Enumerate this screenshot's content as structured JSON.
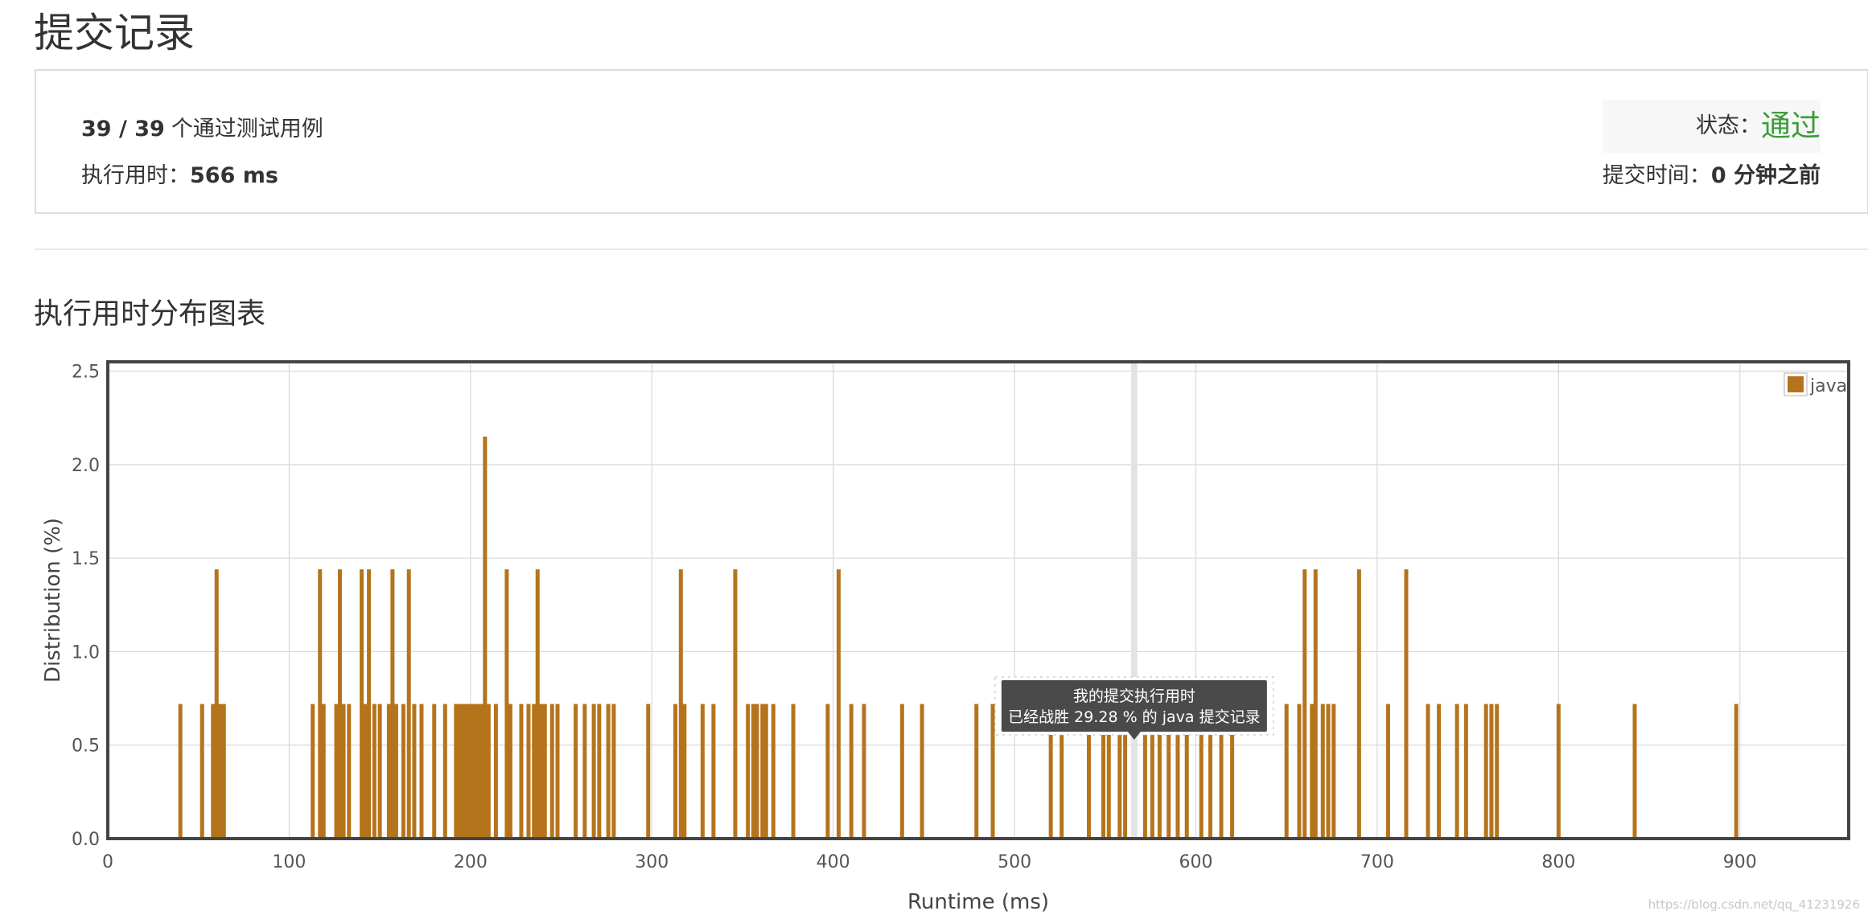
{
  "page": {
    "title": "提交记录",
    "watermark": "https://blog.csdn.net/qq_41231926"
  },
  "summary": {
    "testcases_passed": "39 / 39",
    "testcases_suffix": "个通过测试用例",
    "runtime_label": "执行用时：",
    "runtime_value": "566 ms",
    "status_label": "状态：",
    "status_value": "通过",
    "submit_time_label": "提交时间：",
    "submit_time_value": "0 分钟之前"
  },
  "colors": {
    "bar": "#b5741c",
    "status_green": "#3a9d3a",
    "tooltip_bg": "#4a4a4a"
  },
  "chart_data": {
    "type": "bar",
    "title": "执行用时分布图表",
    "xlabel": "Runtime (ms)",
    "ylabel": "Distribution (%)",
    "xlim": [
      0,
      960
    ],
    "ylim": [
      0,
      2.55
    ],
    "x_ticks": [
      0,
      100,
      200,
      300,
      400,
      500,
      600,
      700,
      800,
      900
    ],
    "y_ticks": [
      "0.0",
      "0.5",
      "1.0",
      "1.5",
      "2.0",
      "2.5"
    ],
    "grid": true,
    "legend": {
      "position": "top-right",
      "entries": [
        "java"
      ]
    },
    "highlight_x": 566,
    "tooltip": {
      "line1": "我的提交执行用时",
      "line2": "已经战胜 29.28 % 的 java 提交记录"
    },
    "series": [
      {
        "name": "java",
        "points": [
          [
            40,
            0.72
          ],
          [
            52,
            0.72
          ],
          [
            58,
            0.72
          ],
          [
            60,
            1.44
          ],
          [
            62,
            0.72
          ],
          [
            64,
            0.72
          ],
          [
            113,
            0.72
          ],
          [
            117,
            1.44
          ],
          [
            119,
            0.72
          ],
          [
            126,
            0.72
          ],
          [
            128,
            1.44
          ],
          [
            130,
            0.72
          ],
          [
            133,
            0.72
          ],
          [
            140,
            1.44
          ],
          [
            142,
            0.72
          ],
          [
            144,
            1.44
          ],
          [
            147,
            0.72
          ],
          [
            150,
            0.72
          ],
          [
            155,
            0.72
          ],
          [
            157,
            1.44
          ],
          [
            159,
            0.72
          ],
          [
            163,
            0.72
          ],
          [
            166,
            1.44
          ],
          [
            169,
            0.72
          ],
          [
            173,
            0.72
          ],
          [
            180,
            0.72
          ],
          [
            186,
            0.72
          ],
          [
            192,
            0.72
          ],
          [
            194,
            0.72
          ],
          [
            196,
            0.72
          ],
          [
            198,
            0.72
          ],
          [
            200,
            0.72
          ],
          [
            202,
            0.72
          ],
          [
            204,
            0.72
          ],
          [
            206,
            0.72
          ],
          [
            208,
            2.15
          ],
          [
            210,
            0.72
          ],
          [
            214,
            0.72
          ],
          [
            220,
            1.44
          ],
          [
            222,
            0.72
          ],
          [
            228,
            0.72
          ],
          [
            232,
            0.72
          ],
          [
            235,
            0.72
          ],
          [
            237,
            1.44
          ],
          [
            239,
            0.72
          ],
          [
            241,
            0.72
          ],
          [
            245,
            0.72
          ],
          [
            248,
            0.72
          ],
          [
            258,
            0.72
          ],
          [
            263,
            0.72
          ],
          [
            268,
            0.72
          ],
          [
            271,
            0.72
          ],
          [
            276,
            0.72
          ],
          [
            279,
            0.72
          ],
          [
            298,
            0.72
          ],
          [
            313,
            0.72
          ],
          [
            316,
            1.44
          ],
          [
            318,
            0.72
          ],
          [
            328,
            0.72
          ],
          [
            334,
            0.72
          ],
          [
            346,
            1.44
          ],
          [
            353,
            0.72
          ],
          [
            356,
            0.72
          ],
          [
            358,
            0.72
          ],
          [
            361,
            0.72
          ],
          [
            363,
            0.72
          ],
          [
            367,
            0.72
          ],
          [
            378,
            0.72
          ],
          [
            397,
            0.72
          ],
          [
            403,
            1.44
          ],
          [
            410,
            0.72
          ],
          [
            417,
            0.72
          ],
          [
            438,
            0.72
          ],
          [
            449,
            0.72
          ],
          [
            479,
            0.72
          ],
          [
            488,
            0.72
          ],
          [
            520,
            0.72
          ],
          [
            526,
            0.72
          ],
          [
            541,
            0.72
          ],
          [
            549,
            0.72
          ],
          [
            552,
            0.72
          ],
          [
            558,
            0.72
          ],
          [
            561,
            0.72
          ],
          [
            572,
            0.72
          ],
          [
            576,
            0.72
          ],
          [
            580,
            0.72
          ],
          [
            585,
            0.72
          ],
          [
            590,
            0.72
          ],
          [
            595,
            0.72
          ],
          [
            603,
            0.72
          ],
          [
            608,
            0.72
          ],
          [
            614,
            0.72
          ],
          [
            620,
            0.72
          ],
          [
            650,
            0.72
          ],
          [
            657,
            0.72
          ],
          [
            660,
            1.44
          ],
          [
            664,
            0.72
          ],
          [
            666,
            1.44
          ],
          [
            670,
            0.72
          ],
          [
            673,
            0.72
          ],
          [
            676,
            0.72
          ],
          [
            690,
            1.44
          ],
          [
            706,
            0.72
          ],
          [
            716,
            1.44
          ],
          [
            728,
            0.72
          ],
          [
            734,
            0.72
          ],
          [
            744,
            0.72
          ],
          [
            749,
            0.72
          ],
          [
            760,
            0.72
          ],
          [
            763,
            0.72
          ],
          [
            766,
            0.72
          ],
          [
            800,
            0.72
          ],
          [
            842,
            0.72
          ],
          [
            898,
            0.72
          ]
        ]
      }
    ]
  }
}
